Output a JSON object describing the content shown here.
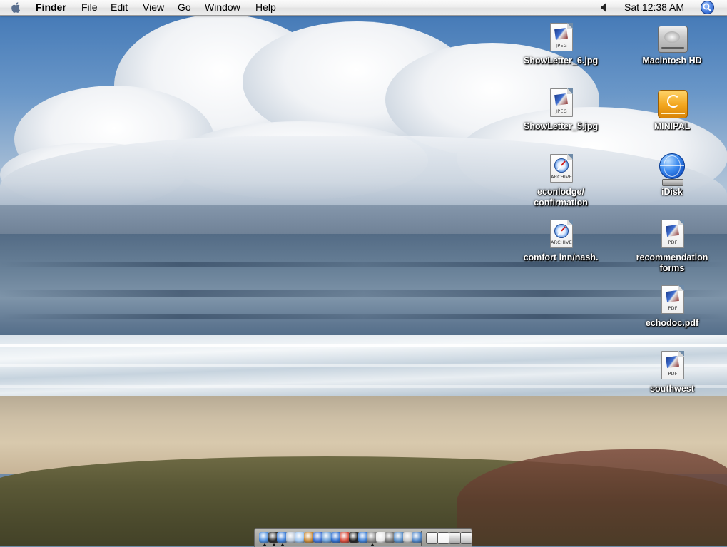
{
  "menubar": {
    "app_name": "Finder",
    "menus": [
      "File",
      "Edit",
      "View",
      "Go",
      "Window",
      "Help"
    ],
    "clock": "Sat 12:38 AM"
  },
  "desktop": {
    "icons": [
      {
        "label": "ShowLetter_6.jpg",
        "kind": "jpeg-document",
        "tag": "JPEG"
      },
      {
        "label": "Macintosh HD",
        "kind": "hard-drive"
      },
      {
        "label": "ShowLetter_5.jpg",
        "kind": "jpeg-document",
        "tag": "JPEG"
      },
      {
        "label": "MINIPAL",
        "kind": "external-drive"
      },
      {
        "label": "econlodge/\nconfirmation",
        "kind": "web-archive",
        "tag": "ARCHIVE"
      },
      {
        "label": "iDisk",
        "kind": "idisk"
      },
      {
        "label": "comfort inn/nash.",
        "kind": "web-archive",
        "tag": "ARCHIVE"
      },
      {
        "label": "recommendation\nforms",
        "kind": "pdf-document",
        "tag": "PDF"
      },
      {
        "label": "echodoc.pdf",
        "kind": "pdf-document",
        "tag": "PDF"
      },
      {
        "label": "southwest",
        "kind": "pdf-document",
        "tag": "PDF"
      }
    ]
  },
  "dock": {
    "apps": [
      {
        "name": "finder-icon",
        "color": "#4d8fe0",
        "running": true
      },
      {
        "name": "dashboard-icon",
        "color": "#2b2b2b",
        "running": true
      },
      {
        "name": "safari-icon",
        "color": "#3e7fd8",
        "running": true
      },
      {
        "name": "mail-icon",
        "color": "#b7c4d4",
        "running": false
      },
      {
        "name": "ichat-icon",
        "color": "#9fc6f0",
        "running": false
      },
      {
        "name": "address-book-icon",
        "color": "#c98b3a",
        "running": false
      },
      {
        "name": "itunes-icon",
        "color": "#3f73d3",
        "running": false
      },
      {
        "name": "iphoto-icon",
        "color": "#6b9fd6",
        "running": false
      },
      {
        "name": "quicktime-icon",
        "color": "#2f6fcf",
        "running": false
      },
      {
        "name": "ical-icon",
        "color": "#d84b3b",
        "running": false
      },
      {
        "name": "dvd-player-icon",
        "color": "#222222",
        "running": false
      },
      {
        "name": "preview-icon",
        "color": "#3d7fd6",
        "running": false
      },
      {
        "name": "system-preferences-icon",
        "color": "#8a8a8a",
        "running": true
      },
      {
        "name": "textedit-icon",
        "color": "#e8e8e8",
        "running": false
      },
      {
        "name": "calculator-icon",
        "color": "#7a7a7a",
        "running": false
      },
      {
        "name": "network-utility-icon",
        "color": "#5a8fc8",
        "running": false
      },
      {
        "name": "grapher-icon",
        "color": "#c8c8c8",
        "running": false
      },
      {
        "name": "utilities-icon",
        "color": "#4f86c9",
        "running": false
      }
    ],
    "docs": [
      {
        "name": "downloads-stack-icon",
        "color": "#d6d6d6"
      },
      {
        "name": "minimized-window-icon",
        "color": "#f2f2f2"
      },
      {
        "name": "documents-icon",
        "color": "#a7a7a7"
      },
      {
        "name": "trash-icon",
        "color": "#b9b9b9"
      }
    ]
  }
}
